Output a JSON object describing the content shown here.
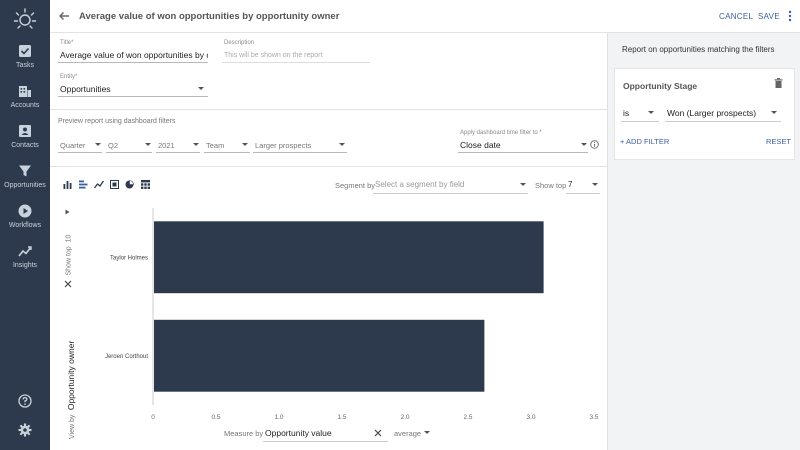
{
  "sidebar": {
    "logo": "sun-logo-icon",
    "items": [
      {
        "label": "Tasks",
        "icon": "tasks-icon"
      },
      {
        "label": "Accounts",
        "icon": "accounts-icon"
      },
      {
        "label": "Contacts",
        "icon": "contacts-icon"
      },
      {
        "label": "Opportunities",
        "icon": "filter-icon"
      },
      {
        "label": "Workflows",
        "icon": "play-icon"
      },
      {
        "label": "Insights",
        "icon": "insights-icon"
      }
    ],
    "bottom": [
      {
        "icon": "help-icon"
      },
      {
        "icon": "gear-icon"
      }
    ]
  },
  "header": {
    "title": "Average value of won opportunities by opportunity owner",
    "cancel_label": "CANCEL",
    "save_label": "SAVE"
  },
  "form": {
    "title_label": "Title",
    "title_value": "Average value of won opportunities by o",
    "description_label": "Description",
    "description_placeholder": "This will be shown on the report",
    "entity_label": "Entity",
    "entity_value": "Opportunities"
  },
  "preview": {
    "label": "Preview report using dashboard filters",
    "filters": [
      "Quarter",
      "Q2",
      "2021",
      "Team",
      "Larger prospects"
    ],
    "time_filter_label": "Apply dashboard time filter to",
    "time_filter_value": "Close date"
  },
  "chart_toolbar": {
    "icons": [
      "bar-chart-icon",
      "horizontal-bar-icon",
      "line-chart-icon",
      "table-icon",
      "pie-chart-icon",
      "grid-icon"
    ],
    "segment_label": "Segment by",
    "segment_placeholder": "Select a segment by field",
    "show_top_label": "Show top",
    "show_top_value": "7"
  },
  "view_by": {
    "show_top_label": "Show top",
    "show_top_value": "10",
    "view_by_label": "View by",
    "view_by_value": "Opportunity owner"
  },
  "measure": {
    "label": "Measure by",
    "field": "Opportunity value",
    "aggregate": "average"
  },
  "chart_data": {
    "type": "bar",
    "orientation": "horizontal",
    "categories": [
      "Taylor Holmes",
      "Jeroen Corthout"
    ],
    "values": [
      3.1,
      2.63
    ],
    "xlim": [
      0,
      3.5
    ],
    "xticks": [
      "0",
      "0.5",
      "1.0",
      "1.5",
      "2.0",
      "2.5",
      "3.0",
      "3.5"
    ],
    "bar_color": "#2d3a4e"
  },
  "filters_panel": {
    "title": "Report on opportunities matching the filters",
    "filter": {
      "field": "Opportunity Stage",
      "operator": "is",
      "value": "Won (Larger prospects)"
    },
    "add_filter_label": "+ ADD FILTER",
    "reset_label": "RESET"
  },
  "colors": {
    "sidebar": "#2d3a4e",
    "accent": "#3b5fa0",
    "bar": "#2d3a4e"
  }
}
